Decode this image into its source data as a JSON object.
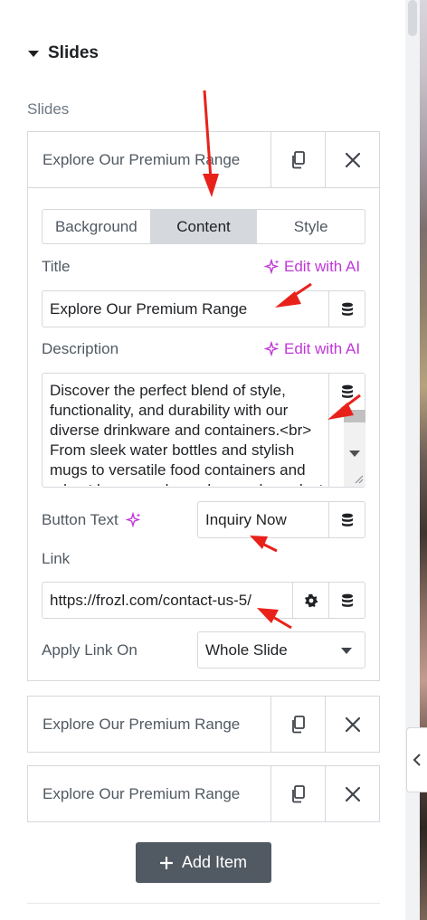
{
  "section": {
    "title": "Slides"
  },
  "repeater": {
    "label": "Slides"
  },
  "items": [
    {
      "title": "Explore Our Premium Range"
    },
    {
      "title": "Explore Our Premium Range"
    },
    {
      "title": "Explore Our Premium Range"
    }
  ],
  "tabs": [
    {
      "label": "Background",
      "active": false
    },
    {
      "label": "Content",
      "active": true
    },
    {
      "label": "Style",
      "active": false
    }
  ],
  "title_control": {
    "label": "Title",
    "ai_label": "Edit with AI",
    "value": "Explore Our Premium Range"
  },
  "description_control": {
    "label": "Description",
    "ai_label": "Edit with AI",
    "value": "Discover the perfect blend of style, functionality, and durability with our diverse drinkware and containers.<br> From sleek water bottles and stylish mugs to versatile food containers and robust beer growlers, <br> each product"
  },
  "button_text_control": {
    "label": "Button Text",
    "value": "Inquiry Now"
  },
  "link_control": {
    "label": "Link",
    "value": "https://frozl.com/contact-us-5/"
  },
  "apply_link_control": {
    "label": "Apply Link On",
    "value": "Whole Slide"
  },
  "add_item": {
    "label": "Add Item"
  },
  "icons": {
    "caret": "caret-down-icon",
    "duplicate": "copy-icon",
    "remove": "close-icon",
    "ai": "sparkle-icon",
    "dynamic": "database-icon",
    "settings": "gear-icon",
    "collapse": "chevron-left-icon",
    "add": "plus-icon"
  },
  "colors": {
    "accent_ai": "#c036d9",
    "tab_active_bg": "#d5d8dc",
    "add_button_bg": "#515962",
    "annotation_arrow": "#e8221b"
  }
}
